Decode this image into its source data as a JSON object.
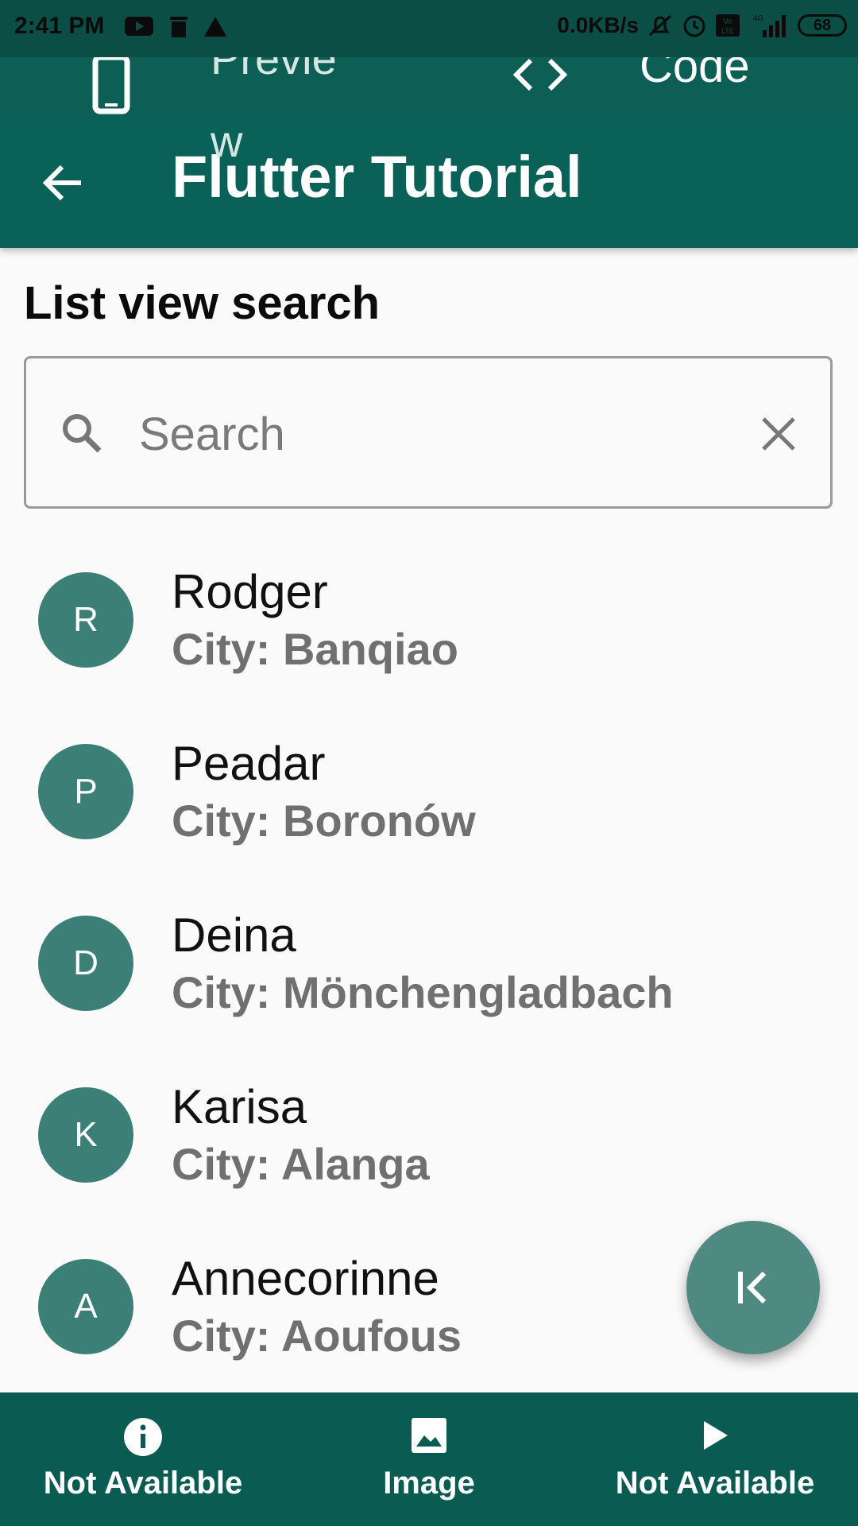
{
  "status_bar": {
    "time": "2:41 PM",
    "net_speed": "0.0KB/s",
    "network": "4G",
    "battery": "68"
  },
  "top_tabs": {
    "preview_label": "Preview",
    "code_label": "Code"
  },
  "app_bar": {
    "title": "Flutter Tutorial"
  },
  "section": {
    "title": "List view search"
  },
  "search": {
    "placeholder": "Search",
    "value": ""
  },
  "list": [
    {
      "initial": "R",
      "name": "Rodger",
      "city": "City: Banqiao"
    },
    {
      "initial": "P",
      "name": "Peadar",
      "city": "City: Boronów"
    },
    {
      "initial": "D",
      "name": "Deina",
      "city": "City: Mönchengladbach"
    },
    {
      "initial": "K",
      "name": "Karisa",
      "city": "City: Alanga"
    },
    {
      "initial": "A",
      "name": "Annecorinne",
      "city": "City: Aoufous"
    }
  ],
  "bottom_nav": [
    {
      "icon": "info-icon",
      "label": "Not Available"
    },
    {
      "icon": "image-icon",
      "label": "Image"
    },
    {
      "icon": "play-icon",
      "label": "Not Available"
    }
  ],
  "colors": {
    "primary": "#0a6157",
    "avatar": "#3c7f76",
    "fab": "#4f8a82",
    "bottom_nav": "#0a5c53"
  }
}
